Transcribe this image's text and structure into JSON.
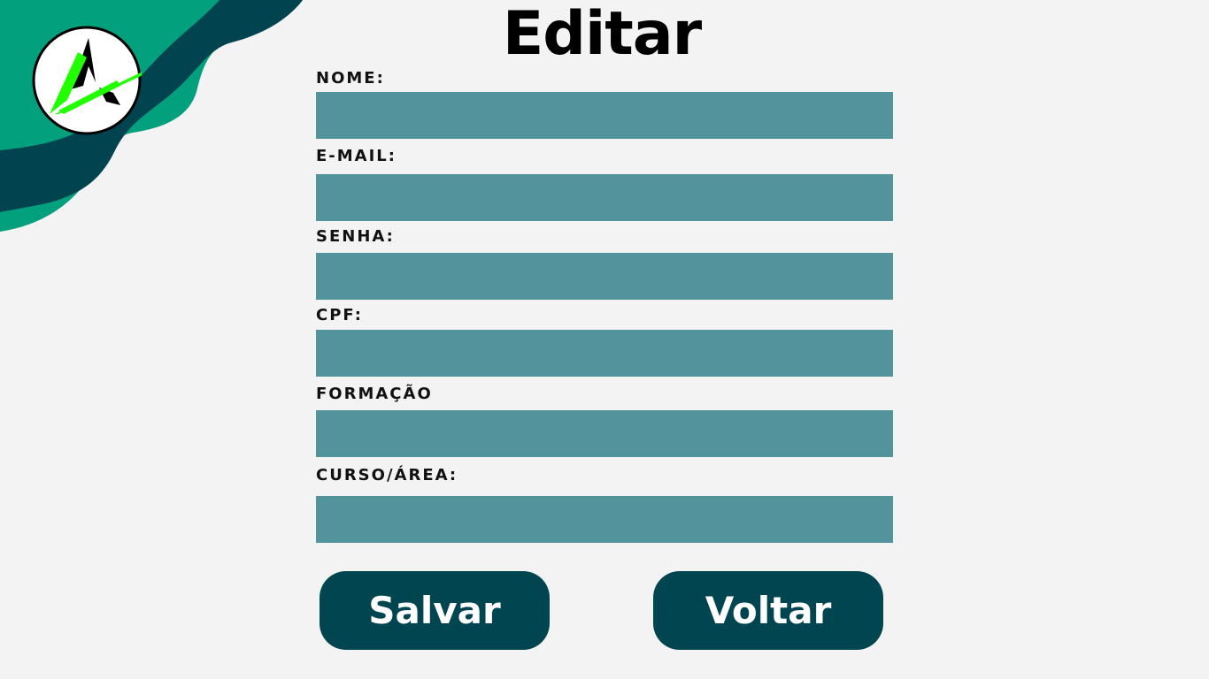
{
  "header": {
    "title": "Editar",
    "logo": {
      "icon": "brand-logo-icon",
      "letter": "A"
    }
  },
  "form": {
    "fields": [
      {
        "label": "NOME:",
        "value": ""
      },
      {
        "label": "E-MAIL:",
        "value": ""
      },
      {
        "label": "SENHA:",
        "value": ""
      },
      {
        "label": "CPF:",
        "value": ""
      },
      {
        "label": "FORMAÇÃO",
        "value": ""
      },
      {
        "label": "CURSO/ÁREA:",
        "value": ""
      }
    ]
  },
  "actions": {
    "save_label": "Salvar",
    "back_label": "Voltar"
  },
  "colors": {
    "background": "#f3f3f3",
    "input_fill": "#52939c",
    "button_fill": "#014550",
    "decor_teal_light": "#02a07c",
    "decor_teal_dark": "#01434f",
    "logo_accent": "#22ff00"
  }
}
